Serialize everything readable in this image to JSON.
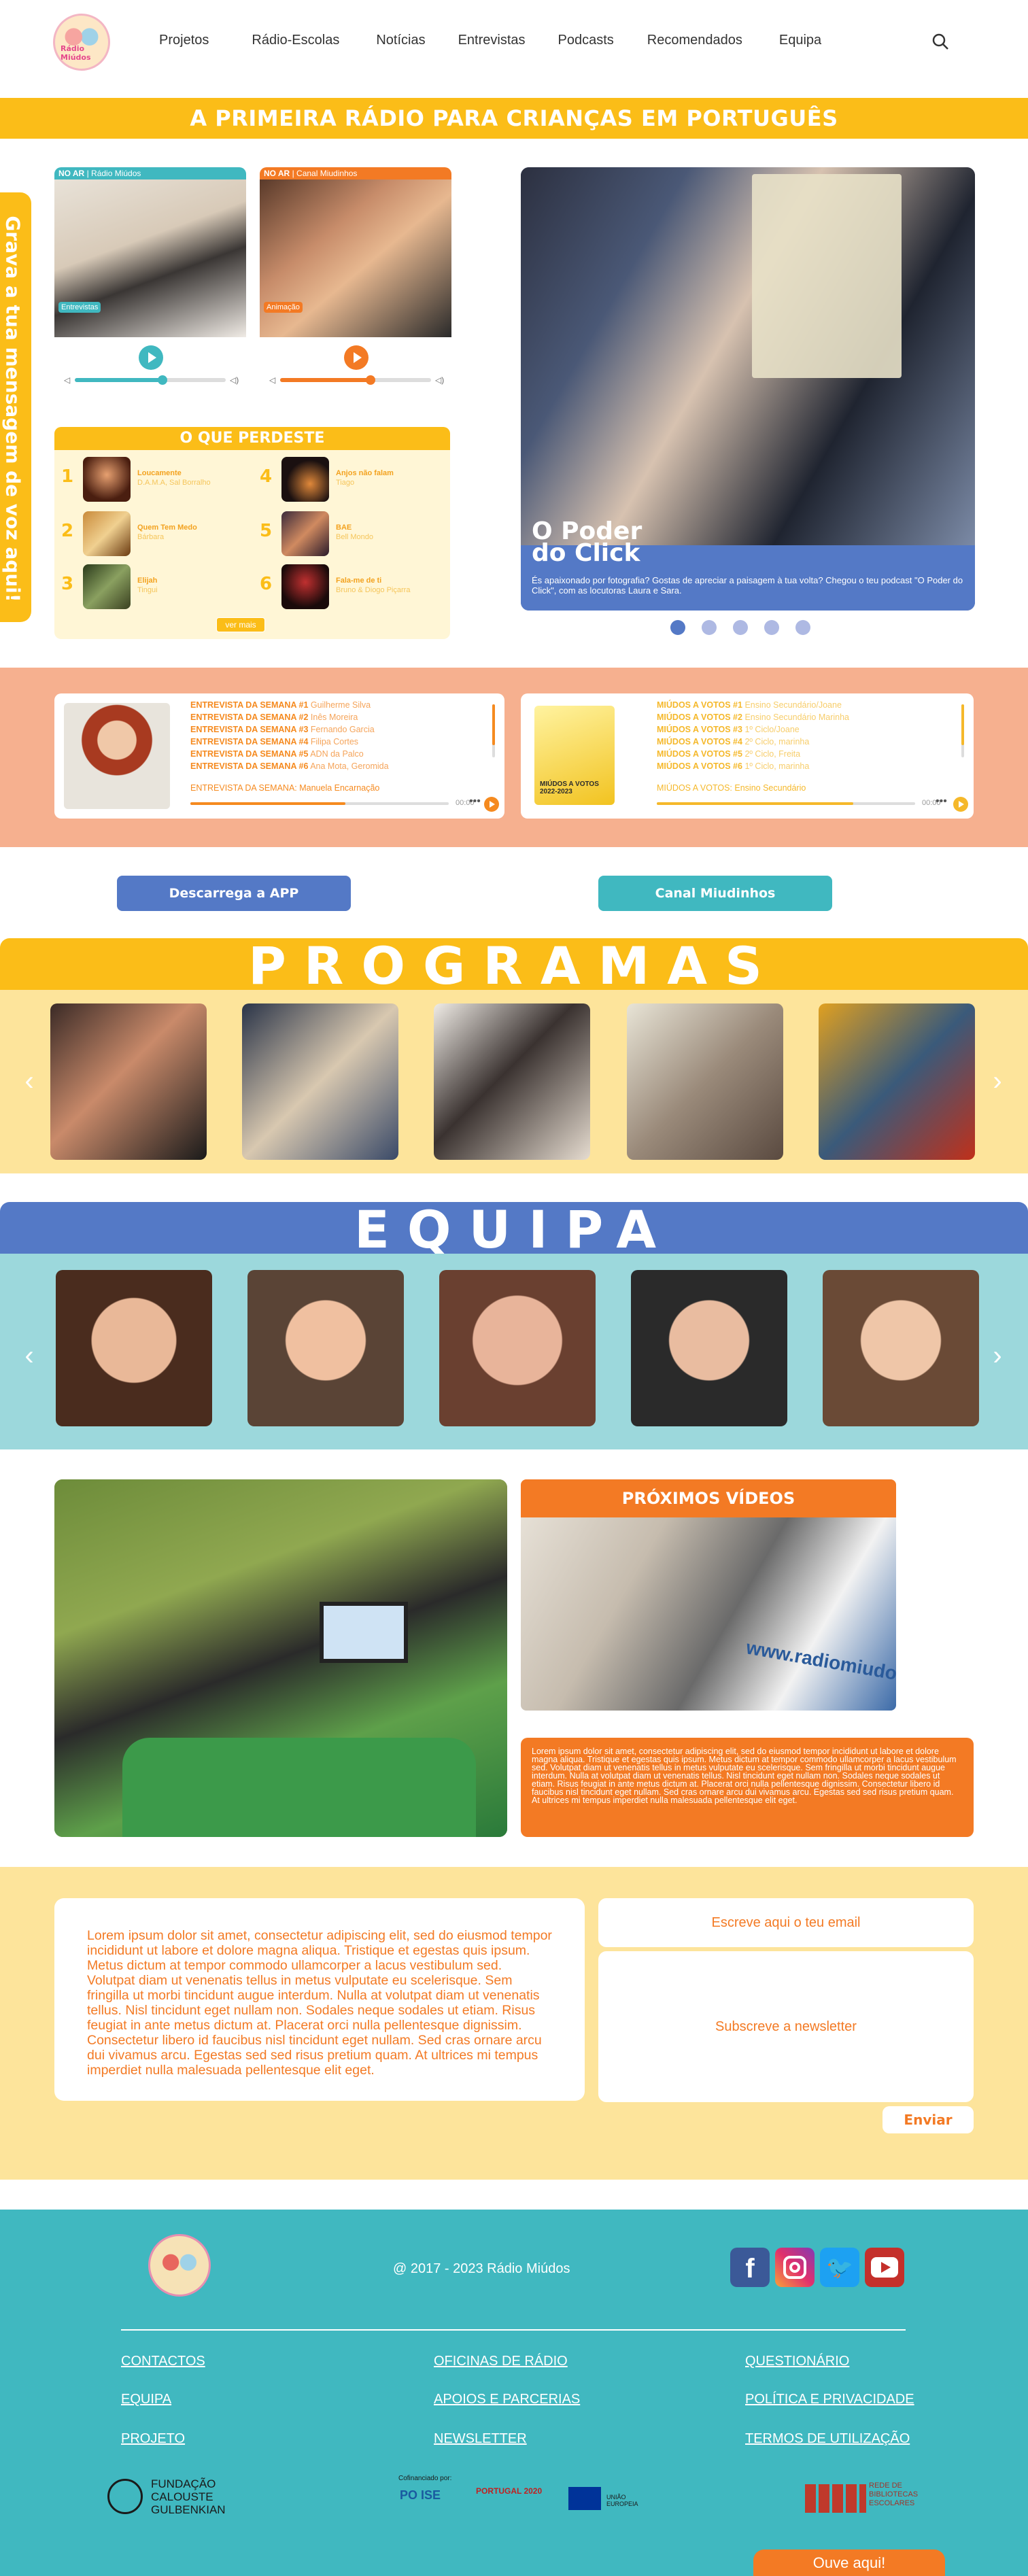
{
  "header": {
    "logo_text": "Rádio Miúdos",
    "nav": [
      "Projetos",
      "Rádio-Escolas",
      "Notícias",
      "Entrevistas",
      "Podcasts",
      "Recomendados",
      "Equipa"
    ]
  },
  "banner": "A PRIMEIRA RÁDIO PARA CRIANÇAS EM PORTUGUÊS",
  "side_tab": "Grava a tua mensagem de voz aqui!",
  "players": [
    {
      "on_air": "NO AR",
      "channel": "Rádio Miúdos",
      "tag": "Entrevistas",
      "accent": "#40b8c0",
      "progress": 0.58
    },
    {
      "on_air": "NO AR",
      "channel": "Canal Miudinhos",
      "tag": "Animação",
      "accent": "#f37a24",
      "progress": 0.6
    }
  ],
  "o_que_perdeste": {
    "title": "O QUE PERDESTE",
    "items": [
      {
        "n": "1",
        "title": "Loucamente",
        "sub": "D.A.M.A, Sal Borralho"
      },
      {
        "n": "2",
        "title": "Quem Tem Medo",
        "sub": "Bárbara"
      },
      {
        "n": "3",
        "title": "Elijah",
        "sub": "Tingui"
      },
      {
        "n": "4",
        "title": "Anjos não falam",
        "sub": "Tiago"
      },
      {
        "n": "5",
        "title": "BAE",
        "sub": "Bell Mondo"
      },
      {
        "n": "6",
        "title": "Fala-me de ti",
        "sub": "Bruno & Diogo Piçarra"
      }
    ],
    "more": "ver mais"
  },
  "hero": {
    "title": "O Poder\ndo Click",
    "desc": "És apaixonado por fotografia? Gostas de apreciar a paisagem à tua volta? Chegou o teu podcast \"O Poder do Click\", com as locutoras Laura e Sara.",
    "slides": 5,
    "active": 0
  },
  "entrevistas": {
    "items": [
      {
        "label": "ENTREVISTA DA SEMANA #1",
        "name": "Guilherme Silva"
      },
      {
        "label": "ENTREVISTA DA SEMANA #2",
        "name": "Inês Moreira"
      },
      {
        "label": "ENTREVISTA DA SEMANA #3",
        "name": "Fernando Garcia"
      },
      {
        "label": "ENTREVISTA DA SEMANA #4",
        "name": "Filipa Cortes"
      },
      {
        "label": "ENTREVISTA DA SEMANA #5",
        "name": "ADN da Palco"
      },
      {
        "label": "ENTREVISTA DA SEMANA #6",
        "name": "Ana Mota, Geromida"
      }
    ],
    "now": "ENTREVISTA DA SEMANA: Manuela Encarnação",
    "time": "00:00",
    "progress": 0.6
  },
  "votos": {
    "badge": "MIÚDOS A VOTOS 2022-2023",
    "items": [
      {
        "label": "MIÚDOS A VOTOS #1",
        "name": "Ensino Secundário/Joane"
      },
      {
        "label": "MIÚDOS A VOTOS #2",
        "name": "Ensino Secundário Marinha"
      },
      {
        "label": "MIÚDOS A VOTOS #3",
        "name": "1º Ciclo/Joane"
      },
      {
        "label": "MIÚDOS A VOTOS #4",
        "name": "2º Ciclo, marinha"
      },
      {
        "label": "MIÚDOS A VOTOS #5",
        "name": "2º Ciclo, Freita"
      },
      {
        "label": "MIÚDOS A VOTOS #6",
        "name": "1º Ciclo, marinha"
      }
    ],
    "now": "MIÚDOS A VOTOS: Ensino Secundário",
    "time": "00:00",
    "progress": 0.76
  },
  "buttons": {
    "app": "Descarrega a APP",
    "canal": "Canal Miudinhos"
  },
  "programas": {
    "title": "PROGRAMAS",
    "count": 5
  },
  "equipa": {
    "title": "EQUIPA",
    "count": 5
  },
  "proximos": {
    "title": "PRÓXIMOS VÍDEOS",
    "sign": "www.radiomiudos",
    "text": "Lorem ipsum dolor sit amet, consectetur adipiscing elit, sed do eiusmod tempor incididunt ut labore et dolore magna aliqua. Tristique et egestas quis ipsum. Metus dictum at tempor commodo ullamcorper a lacus vestibulum sed. Volutpat diam ut venenatis tellus in metus vulputate eu scelerisque. Sem fringilla ut morbi tincidunt augue interdum. Nulla at volutpat diam ut venenatis tellus. Nisl tincidunt eget nullam non. Sodales neque sodales ut etiam. Risus feugiat in ante metus dictum at. Placerat orci nulla pellentesque dignissim. Consectetur libero id faucibus nisl tincidunt eget nullam. Sed cras ornare arcu dui vivamus arcu. Egestas sed sed risus pretium quam. At ultrices mi tempus imperdiet nulla malesuada pellentesque elit eget."
  },
  "newsletter": {
    "text": "Lorem ipsum dolor sit amet, consectetur adipiscing elit, sed do eiusmod tempor incididunt ut labore et dolore magna aliqua. Tristique et egestas quis ipsum. Metus dictum at tempor commodo ullamcorper a lacus vestibulum sed. Volutpat diam ut venenatis tellus in metus vulputate eu scelerisque. Sem fringilla ut morbi tincidunt augue interdum. Nulla at volutpat diam ut venenatis tellus. Nisl tincidunt eget nullam non. Sodales neque sodales ut etiam. Risus feugiat in ante metus dictum at. Placerat orci nulla pellentesque dignissim. Consectetur libero id faucibus nisl tincidunt eget nullam. Sed cras ornare arcu dui vivamus arcu. Egestas sed sed risus pretium quam. At ultrices mi tempus imperdiet nulla malesuada pellentesque elit eget.",
    "email_placeholder": "Escreve aqui o teu email",
    "subscribe": "Subscreve a newsletter",
    "send": "Enviar"
  },
  "footer": {
    "copyright": "@ 2017 - 2023 Rádio Miúdos",
    "links": {
      "col1": [
        "CONTACTOS",
        "EQUIPA",
        "PROJETO"
      ],
      "col2": [
        "OFICINAS DE RÁDIO",
        "APOIOS E PARCERIAS",
        "NEWSLETTER"
      ],
      "col3": [
        "QUESTIONÁRIO",
        "POLÍTICA E PRIVACIDADE",
        "TERMOS DE UTILIZAÇÃO"
      ]
    },
    "partners": {
      "gulbenkian": "FUNDAÇÃO CALOUSTE GULBENKIAN",
      "cofinanciado": "Cofinanciado por:",
      "po": "PO ISE",
      "portugal": "PORTUGAL 2020",
      "ue": "UNIÃO EUROPEIA",
      "rbe": "REDE DE BIBLIOTECAS ESCOLARES"
    },
    "social": [
      "facebook-icon",
      "instagram-icon",
      "twitter-icon",
      "youtube-icon"
    ],
    "ouve": "Ouve aqui!"
  },
  "colors": {
    "yellow": "#fbbd18",
    "orange": "#f37a24",
    "teal": "#40b8c0",
    "blue": "#5479c6",
    "salmon": "#f6b08f"
  }
}
